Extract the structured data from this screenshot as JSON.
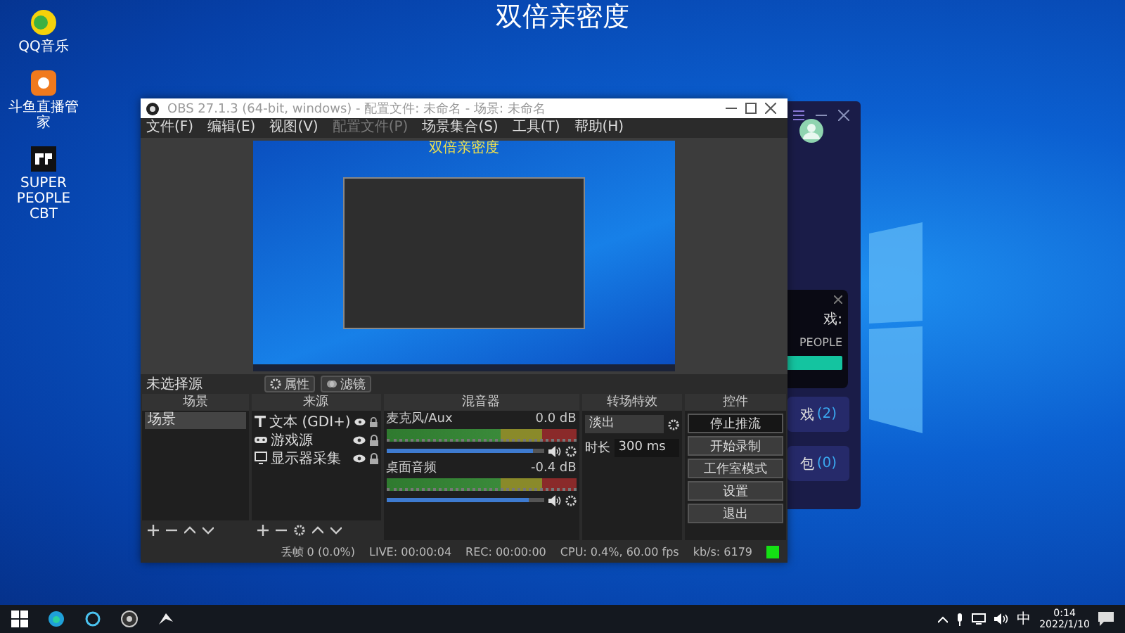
{
  "desktop": {
    "heading": "双倍亲密度",
    "icons": [
      {
        "label": "QQ音乐",
        "kind": "music"
      },
      {
        "label": "斗鱼直播管家",
        "kind": "stream"
      },
      {
        "label": "SUPER PEOPLE CBT",
        "kind": "game"
      }
    ]
  },
  "background_app": {
    "popup": {
      "title": "戏:",
      "subtitle": "PEOPLE"
    },
    "items": [
      {
        "label": "戏",
        "count": "(2)"
      },
      {
        "label": "包",
        "count": "(0)"
      }
    ]
  },
  "obs": {
    "title": "OBS 27.1.3 (64-bit, windows) - 配置文件: 未命名 - 场景: 未命名",
    "menu": [
      {
        "label": "文件(F)",
        "disabled": false
      },
      {
        "label": "编辑(E)",
        "disabled": false
      },
      {
        "label": "视图(V)",
        "disabled": false
      },
      {
        "label": "配置文件(P)",
        "disabled": true
      },
      {
        "label": "场景集合(S)",
        "disabled": false
      },
      {
        "label": "工具(T)",
        "disabled": false
      },
      {
        "label": "帮助(H)",
        "disabled": false
      }
    ],
    "preview": {
      "title": "双倍亲密度"
    },
    "source_bar": {
      "label": "未选择源",
      "buttons": [
        {
          "label": "属性",
          "kind": "properties"
        },
        {
          "label": "滤镜",
          "kind": "filters"
        }
      ]
    },
    "scenes": {
      "title": "场景",
      "items": [
        {
          "label": "场景",
          "selected": true
        }
      ]
    },
    "sources": {
      "title": "来源",
      "items": [
        {
          "label": "文本 (GDI+)",
          "kind": "text",
          "visible": true
        },
        {
          "label": "游戏源",
          "kind": "game",
          "visible": true
        },
        {
          "label": "显示器采集",
          "kind": "display",
          "visible": true
        }
      ]
    },
    "mixer": {
      "title": "混音器",
      "channels": [
        {
          "name": "麦克风/Aux",
          "reading": "0.0 dB",
          "level": 0.93
        },
        {
          "name": "桌面音频",
          "reading": "-0.4 dB",
          "level": 0.9
        }
      ]
    },
    "transitions": {
      "title": "转场特效",
      "selected": "淡出",
      "duration_label": "时长",
      "duration": "300 ms"
    },
    "controls": {
      "title": "控件",
      "buttons": [
        {
          "label": "停止推流",
          "active": true
        },
        {
          "label": "开始录制",
          "active": false
        },
        {
          "label": "工作室模式",
          "active": false
        },
        {
          "label": "设置",
          "active": false
        },
        {
          "label": "退出",
          "active": false
        }
      ]
    },
    "status": {
      "dropped": "丢帧 0 (0.0%)",
      "live": "LIVE: 00:00:04",
      "rec": "REC: 00:00:00",
      "cpu": "CPU: 0.4%, 60.00 fps",
      "bitrate": "kb/s: 6179",
      "streaming": true
    }
  },
  "taskbar": {
    "ime": "中",
    "time": "0:14",
    "date": "2022/1/10"
  }
}
